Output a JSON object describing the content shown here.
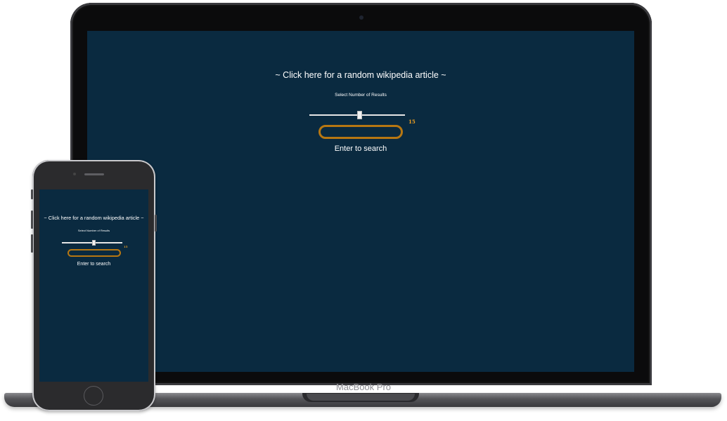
{
  "laptop": {
    "brand": "MacBook Pro"
  },
  "app": {
    "random_link": "~ Click here for a random wikipedia article ~",
    "select_label": "Select Number of Results",
    "results_count": "15",
    "slider_value": 15,
    "search_value": "",
    "enter_hint": "Enter to search"
  },
  "colors": {
    "background": "#0a2a40",
    "accent": "#b77712",
    "count": "#f0a020"
  }
}
